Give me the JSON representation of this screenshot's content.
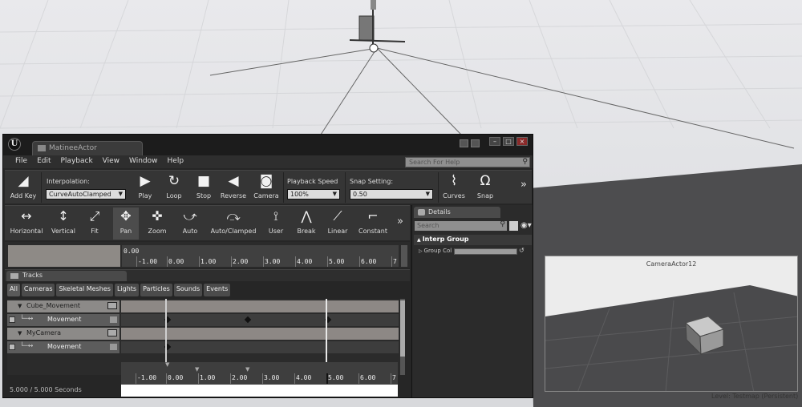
{
  "window": {
    "tab_title": "MatineeActor",
    "search_help_placeholder": "Search For Help"
  },
  "menu": [
    "File",
    "Edit",
    "Playback",
    "View",
    "Window",
    "Help"
  ],
  "toolbar1": {
    "add_key": "Add Key",
    "interpolation_label": "Interpolation:",
    "interpolation_value": "CurveAutoClamped",
    "play": "Play",
    "loop": "Loop",
    "stop": "Stop",
    "reverse": "Reverse",
    "camera": "Camera",
    "playback_speed_label": "Playback Speed",
    "playback_speed_value": "100%",
    "snap_setting_label": "Snap Setting:",
    "snap_setting_value": "0.50",
    "curves": "Curves",
    "snap": "Snap"
  },
  "toolbar2": [
    "Horizontal",
    "Vertical",
    "Fit",
    "Pan",
    "Zoom",
    "Auto",
    "Auto/Clamped",
    "User",
    "Break",
    "Linear",
    "Constant"
  ],
  "curve_editor": {
    "zero_label": "0.00",
    "ticks": [
      "-1.00",
      "0.00",
      "1.00",
      "2.00",
      "3.00",
      "4.00",
      "5.00",
      "6.00",
      "7"
    ]
  },
  "tracks": {
    "tab_label": "Tracks",
    "filters": [
      "All",
      "Cameras",
      "Skeletal Meshes",
      "Lights",
      "Particles",
      "Sounds",
      "Events"
    ],
    "rows": [
      {
        "kind": "group",
        "label": "Cube_Movement"
      },
      {
        "kind": "track",
        "label": "Movement"
      },
      {
        "kind": "group",
        "label": "MyCamera"
      },
      {
        "kind": "track",
        "label": "Movement"
      }
    ],
    "timeline_ticks": [
      "-1.00",
      "0.00",
      "1.00",
      "2.00",
      "3.00",
      "4.00",
      "5.00",
      "6.00",
      "7"
    ],
    "status": "5.000 / 5.000 Seconds"
  },
  "details": {
    "tab_label": "Details",
    "search_placeholder": "Search",
    "group_label": "Interp Group",
    "property_label": "Group Col"
  },
  "camera_preview": {
    "title": "CameraActor12"
  },
  "level_status": "Level:  Testmap (Persistent)",
  "colors": {
    "viewport_bg": "#e6e6e9",
    "window_bg": "#262626",
    "group_row": "#8c8a88",
    "track_row": "#5c5c5c"
  }
}
